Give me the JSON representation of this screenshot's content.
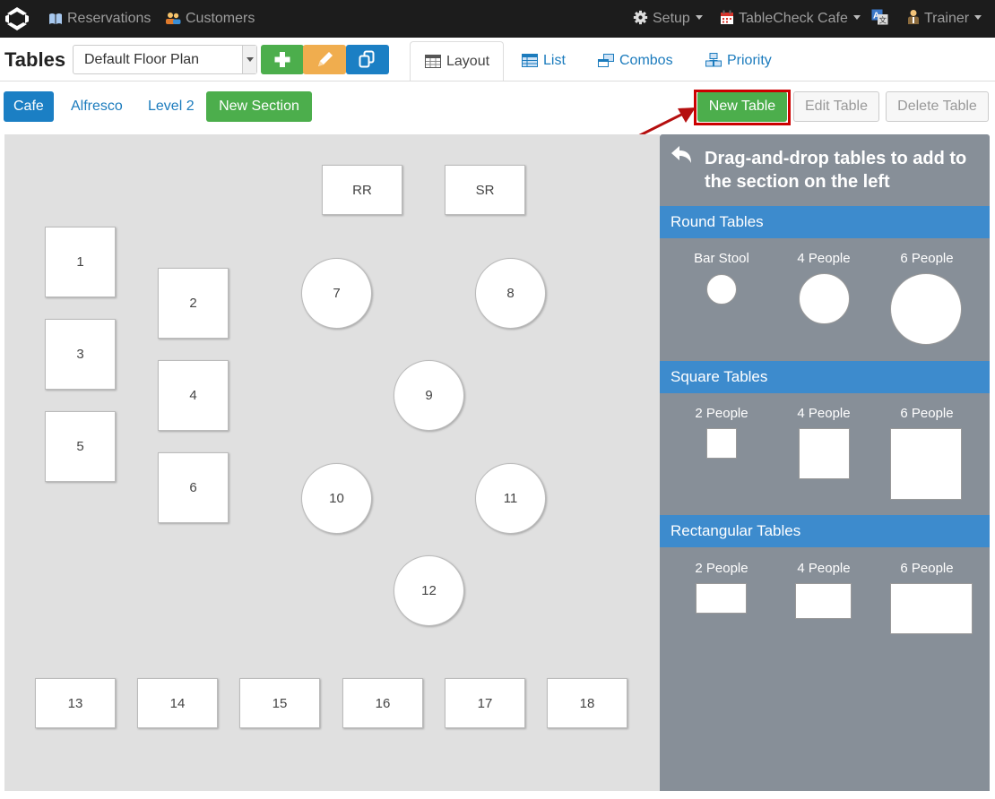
{
  "navbar": {
    "reservations": "Reservations",
    "customers": "Customers",
    "setup": "Setup",
    "venue": "TableCheck Cafe",
    "user": "Trainer",
    "icons": {
      "reservations": "book-icon",
      "customers": "users-icon",
      "setup": "gear-icon",
      "venue": "calendar-icon",
      "language": "translate-icon",
      "user": "person-icon"
    }
  },
  "toolbar": {
    "title": "Tables",
    "floor_plan": "Default Floor Plan",
    "tabs": [
      {
        "label": "Layout",
        "active": true
      },
      {
        "label": "List"
      },
      {
        "label": "Combos"
      },
      {
        "label": "Priority"
      }
    ]
  },
  "sections": {
    "items": [
      "Cafe",
      "Alfresco",
      "Level 2"
    ],
    "active": "Cafe",
    "new_section": "New Section"
  },
  "actions": {
    "new_table": "New Table",
    "edit_table": "Edit Table",
    "delete_table": "Delete Table"
  },
  "floor": {
    "tables": [
      "RR",
      "SR",
      "1",
      "2",
      "3",
      "4",
      "5",
      "6",
      "7",
      "8",
      "9",
      "10",
      "11",
      "12",
      "13",
      "14",
      "15",
      "16",
      "17",
      "18"
    ]
  },
  "palette": {
    "title": "Drag-and-drop tables to add to the section on the left",
    "round": {
      "title": "Round Tables",
      "labels": [
        "Bar Stool",
        "4 People",
        "6 People"
      ]
    },
    "square": {
      "title": "Square Tables",
      "labels": [
        "2 People",
        "4 People",
        "6 People"
      ]
    },
    "rect": {
      "title": "Rectangular Tables",
      "labels": [
        "2 People",
        "4 People",
        "6 People"
      ]
    }
  },
  "colors": {
    "navbar": "#1c1c1c",
    "primary": "#1b7fc4",
    "success": "#4cae4c",
    "warning": "#f0ad4e",
    "panel": "#878f98",
    "category": "#3d8bcd",
    "highlight": "#cc0000"
  }
}
